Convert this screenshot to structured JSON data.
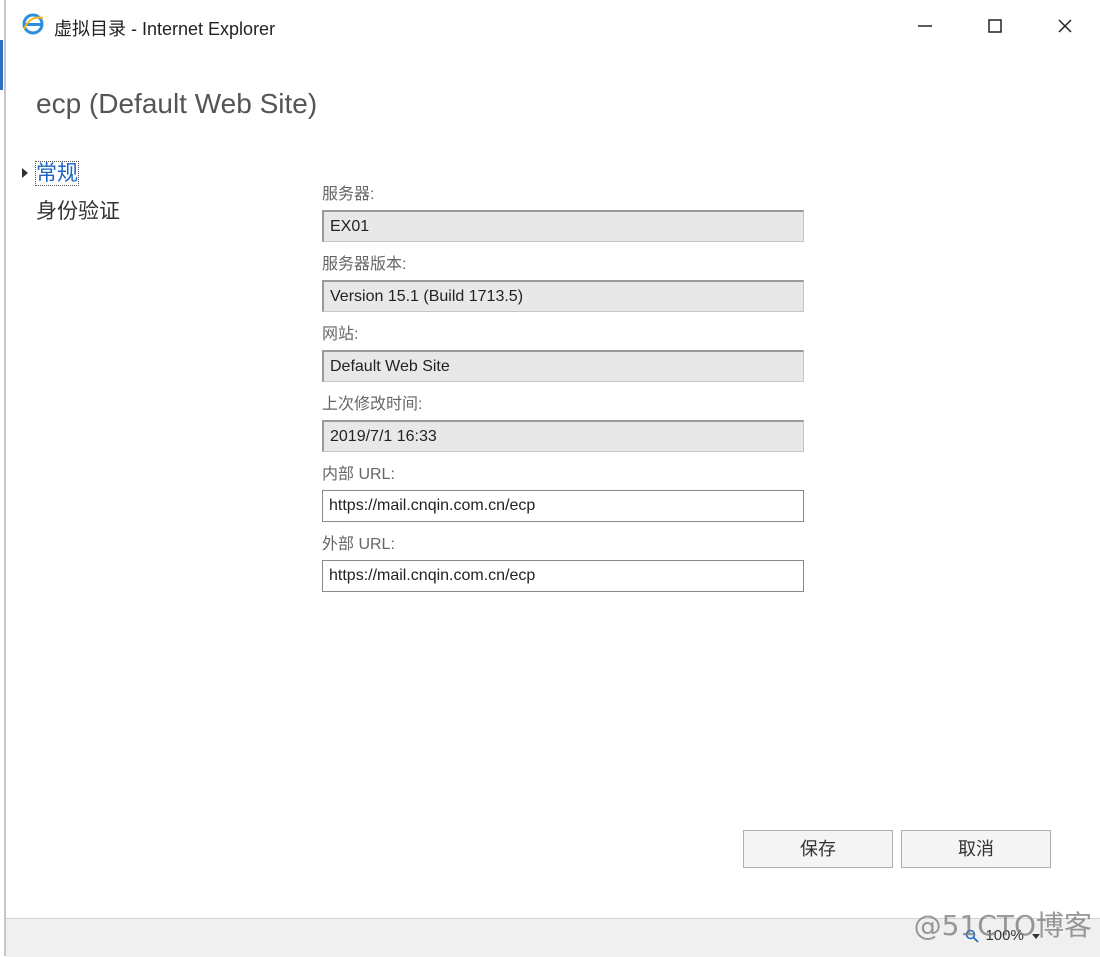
{
  "window": {
    "title": "虚拟目录 - Internet Explorer",
    "icon": "internet-explorer-icon",
    "controls": {
      "minimize": "—",
      "maximize": "☐",
      "close": "✕"
    }
  },
  "page": {
    "heading": "ecp (Default Web Site)"
  },
  "nav": {
    "items": [
      {
        "label": "常规",
        "active": true
      },
      {
        "label": "身份验证",
        "active": false
      }
    ]
  },
  "form": {
    "server": {
      "label": "服务器:",
      "value": "EX01"
    },
    "server_version": {
      "label": "服务器版本:",
      "value": "Version 15.1 (Build 1713.5)"
    },
    "website": {
      "label": "网站:",
      "value": "Default Web Site"
    },
    "last_modified": {
      "label": "上次修改时间:",
      "value": "2019/7/1 16:33"
    },
    "internal_url": {
      "label": "内部 URL:",
      "value": "https://mail.cnqin.com.cn/ecp"
    },
    "external_url": {
      "label": "外部 URL:",
      "value": "https://mail.cnqin.com.cn/ecp"
    }
  },
  "buttons": {
    "save": "保存",
    "cancel": "取消"
  },
  "statusbar": {
    "zoom": "100%"
  },
  "watermark": "@51CTO博客",
  "colors": {
    "accent": "#1a66c2",
    "readonly_bg": "#e8e8e8"
  }
}
